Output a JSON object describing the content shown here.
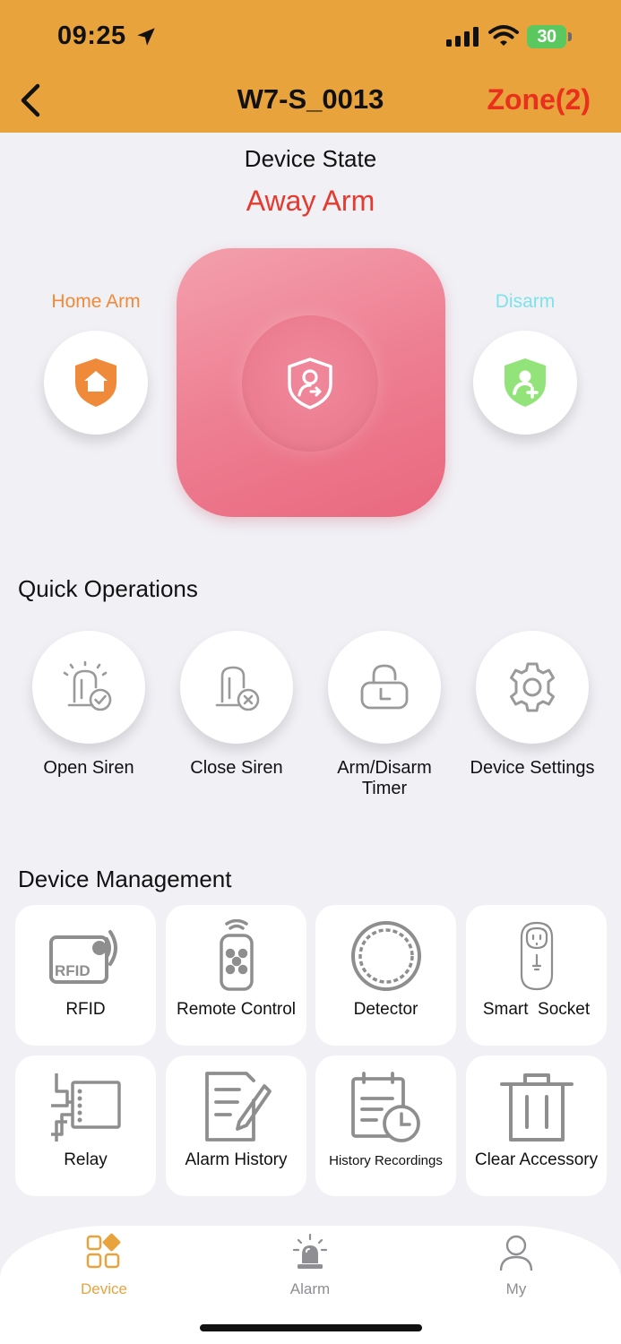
{
  "status_bar": {
    "time": "09:25",
    "battery": "30"
  },
  "header": {
    "title": "W7-S_0013",
    "zone_link": "Zone(2)"
  },
  "device_state": {
    "label": "Device State",
    "value": "Away Arm",
    "home_arm_label": "Home Arm",
    "disarm_label": "Disarm"
  },
  "quick_operations": {
    "title": "Quick Operations",
    "items": [
      {
        "label": "Open Siren",
        "icon": "siren-check-icon"
      },
      {
        "label": "Close Siren",
        "icon": "siren-close-icon"
      },
      {
        "label": "Arm/Disarm Timer",
        "icon": "lock-timer-icon"
      },
      {
        "label": "Device Settings",
        "icon": "gear-icon"
      }
    ]
  },
  "device_management": {
    "title": "Device Management",
    "items": [
      {
        "label": "RFID",
        "icon": "rfid-icon"
      },
      {
        "label": "Remote Control",
        "icon": "remote-control-icon"
      },
      {
        "label": "Detector",
        "icon": "detector-icon"
      },
      {
        "label": "Smart  Socket",
        "icon": "smart-socket-icon"
      },
      {
        "label": "Relay",
        "icon": "relay-icon"
      },
      {
        "label": "Alarm History",
        "icon": "alarm-history-icon"
      },
      {
        "label": "History Recordings",
        "icon": "history-recordings-icon"
      },
      {
        "label": "Clear Accessory",
        "icon": "trash-icon"
      }
    ]
  },
  "tabs": [
    {
      "label": "Device",
      "active": true,
      "icon": "device-grid-icon"
    },
    {
      "label": "Alarm",
      "active": false,
      "icon": "alarm-beacon-icon"
    },
    {
      "label": "My",
      "active": false,
      "icon": "user-icon"
    }
  ],
  "colors": {
    "header_bg": "#e8a33d",
    "state_red": "#e43a2f",
    "home_arm_orange": "#ef8a3a",
    "disarm_cyan": "#7de3ea",
    "disarm_green": "#93e37b",
    "main_pink": "#ee7f93",
    "tab_active": "#e8a33d",
    "tab_inactive": "#8e8e93"
  }
}
